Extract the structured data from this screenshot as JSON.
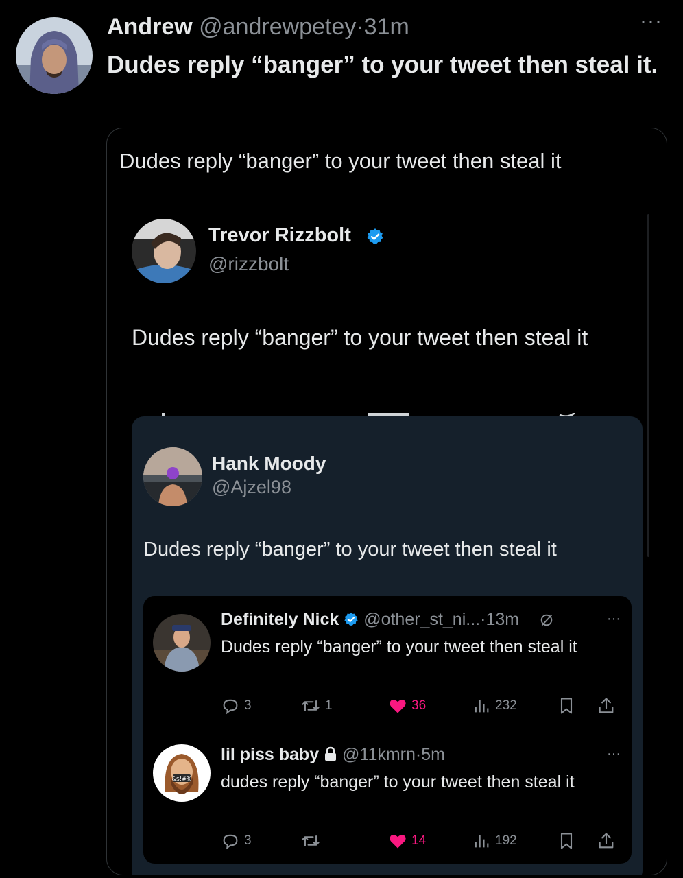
{
  "outer_tweet": {
    "name": "Andrew",
    "handle": "@andrewpetey",
    "separator": "·",
    "time": "31m",
    "more": "···",
    "text": "Dudes reply “banger” to your tweet then steal it."
  },
  "screenshot": {
    "caption": "Dudes reply “banger” to your tweet then steal it",
    "quoted_tweet": {
      "name": "Trevor Rizzbolt",
      "handle": "@rizzbolt",
      "text": "Dudes reply “banger” to your tweet then steal it"
    },
    "inner_tweet": {
      "name": "Hank Moody",
      "handle": "@Ajzel98",
      "text": "Dudes reply “banger” to your tweet then steal it"
    },
    "replies": [
      {
        "name": "Definitely Nick",
        "handle": "@other_st_ni...",
        "separator": "·",
        "time": "13m",
        "more": "···",
        "text": "Dudes reply “banger” to your tweet then steal it",
        "replies": "3",
        "reposts": "1",
        "likes": "36",
        "views": "232"
      },
      {
        "name": "lil piss baby",
        "handle": "@11kmrn",
        "separator": "·",
        "time": "5m",
        "more": "···",
        "text": "dudes reply “banger” to your tweet then steal it",
        "replies": "3",
        "reposts": "",
        "likes": "14",
        "views": "192",
        "avatar_text": "&$!#%"
      }
    ]
  },
  "colors": {
    "background": "#000000",
    "text": "#e7e9ea",
    "muted": "#8b9096",
    "verified": "#1d9bf0",
    "like": "#f91880",
    "inner_card": "#15202b"
  }
}
